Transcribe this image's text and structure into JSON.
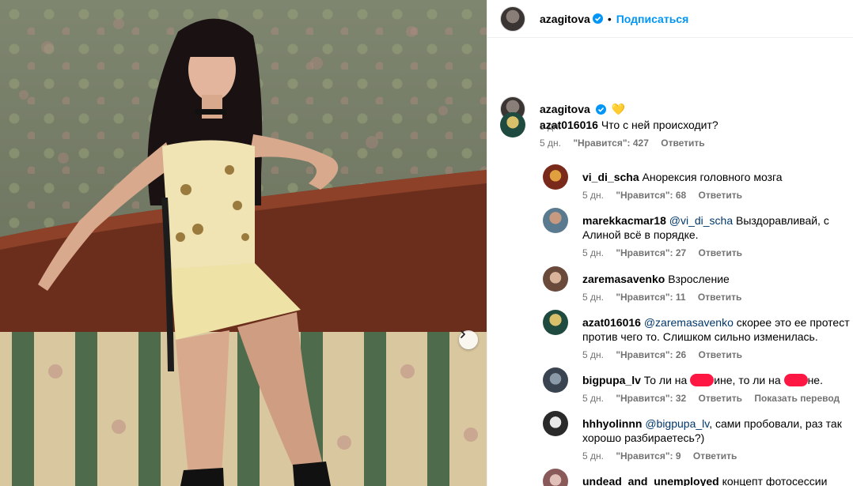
{
  "post": {
    "author": "azagitova",
    "follow_label": "Подписаться",
    "dot": "•"
  },
  "caption": {
    "author": "azagitova",
    "time": "5 дн.",
    "emoji": "💛"
  },
  "comments": [
    {
      "user": "azat016016",
      "text": "Что с ней происходит?",
      "time": "5 дн.",
      "likes": "\"Нравится\": 427",
      "reply": "Ответить"
    },
    {
      "user": "vi_di_scha",
      "text": "Анорексия головного мозга",
      "time": "5 дн.",
      "likes": "\"Нравится\": 68",
      "reply": "Ответить"
    },
    {
      "user": "marekkacmar18",
      "mention": "@vi_di_scha",
      "text": " Выздоравливай, с",
      "text2": "Алиной всё в порядке.",
      "time": "5 дн.",
      "likes": "\"Нравится\": 27",
      "reply": "Ответить"
    },
    {
      "user": "zaremasavenko",
      "text": "Взросление",
      "time": "5 дн.",
      "likes": "\"Нравится\": 11",
      "reply": "Ответить"
    },
    {
      "user": "azat016016",
      "mention": "@zaremasavenko",
      "text": " скорее это ее протест",
      "text2": "против чего то. Слишком сильно изменилась.",
      "time": "5 дн.",
      "likes": "\"Нравится\": 26",
      "reply": "Ответить"
    },
    {
      "user": "bigpupa_lv",
      "text_a": "То ли на ",
      "text_b": "ине, то ли на ",
      "text_c": "не.",
      "time": "5 дн.",
      "likes": "\"Нравится\": 32",
      "reply": "Ответить",
      "translate": "Показать перевод"
    },
    {
      "user": "hhhyolinnn",
      "mention": "@bigpupa_lv",
      "text": ", сами пробовали, раз так",
      "text2": "хорошо разбираетесь?)",
      "time": "5 дн.",
      "likes": "\"Нравится\": 9",
      "reply": "Ответить"
    },
    {
      "user": "undead_and_unemployed",
      "text": "концепт фотосессии"
    }
  ],
  "colors": {
    "link": "#0095f6",
    "mention": "#00376b",
    "meta": "#737373",
    "verified": "#0095f6"
  },
  "icons": {
    "verified": "verified-badge-icon",
    "next": "chevron-right-icon"
  }
}
